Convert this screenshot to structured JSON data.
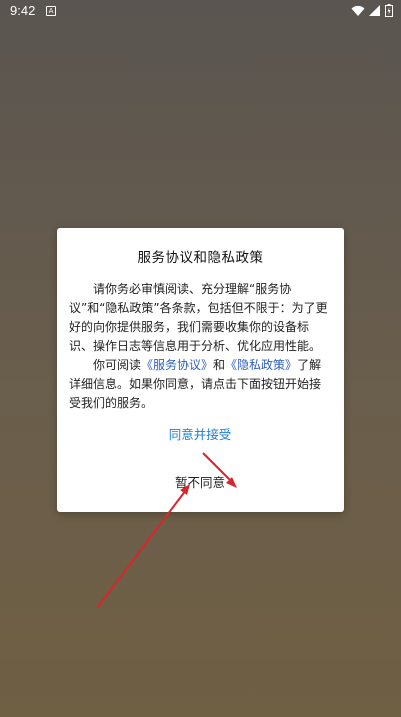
{
  "status_bar": {
    "time": "9:42",
    "notification_glyph": "A",
    "icons": [
      "wifi-icon",
      "signal-icon",
      "battery-icon"
    ]
  },
  "dialog": {
    "title": "服务协议和隐私政策",
    "para1": "请你务必审慎阅读、充分理解“服务协议”和“隐私政策”各条款，包括但不限于：为了更好的向你提供服务，我们需要收集你的设备标识、操作日志等信息用于分析、优化应用性能。",
    "para2_prefix": "你可阅读",
    "service_link": "《服务协议》",
    "para2_and": "和",
    "privacy_link": "《隐私政策》",
    "para2_suffix": "了解详细信息。如果你同意，请点击下面按钮开始接受我们的服务。",
    "accept_label": "同意并接受",
    "decline_label": "暂不同意"
  },
  "colors": {
    "accent": "#1a7dd6",
    "link": "#2e5fb8",
    "annotation_arrow": "#d9262b"
  }
}
